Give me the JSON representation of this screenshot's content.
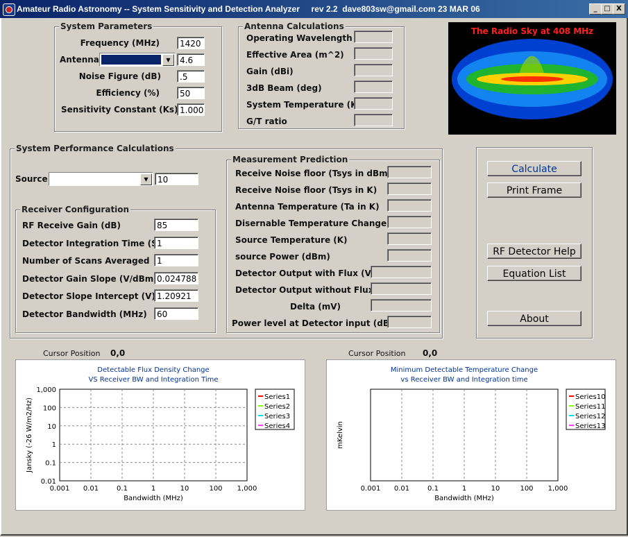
{
  "window": {
    "title": "Amateur Radio Astronomy -- System Sensitivity and Detection Analyzer     rev 2.2  dave803sw@gmail.com 23 MAR 06",
    "minimize": "_",
    "maximize": "□",
    "close": "X"
  },
  "system_params": {
    "legend": "System Parameters",
    "frequency_label": "Frequency (MHz)",
    "frequency": "1420",
    "antenna_label": "Antenna",
    "antenna": "4.6",
    "noise_label": "Noise Figure (dB)",
    "noise": ".5",
    "efficiency_label": "Efficiency (%)",
    "efficiency": "50",
    "ks_label": "Sensitivity Constant (Ks)",
    "ks": "1.000"
  },
  "antenna_calc": {
    "legend": "Antenna Calculations",
    "rows": [
      "Operating Wavelength (m)",
      "Effective  Area (m^2)",
      "Gain (dBi)",
      "3dB Beam (deg)",
      "System Temperature (K)",
      "G/T ratio"
    ]
  },
  "sky": {
    "caption": "The Radio Sky at 408 MHz"
  },
  "perf": {
    "legend": "System Performance Calculations",
    "source_label": "Source",
    "source_value": "10"
  },
  "receiver": {
    "legend": "Receiver Configuration",
    "rows": [
      {
        "label": "RF Receive Gain (dB)",
        "value": "85"
      },
      {
        "label": "Detector Integration Time (S)",
        "value": "1"
      },
      {
        "label": "Number of Scans Averaged",
        "value": "1"
      },
      {
        "label": "Detector Gain Slope (V/dBm)",
        "value": "0.024788"
      },
      {
        "label": "Detector Slope Intercept (V)",
        "value": "1.20921"
      },
      {
        "label": "Detector Bandwidth (MHz)",
        "value": "60"
      }
    ]
  },
  "measurement": {
    "legend": "Measurement Prediction",
    "rows": [
      "Receive Noise floor (Tsys in dBm)",
      "Receive Noise floor (Tsys in K)",
      "Antenna Temperature  (Ta in K)",
      "Disernable Temperature Change (mK)",
      "Source Temperature (K)",
      "source Power (dBm)",
      "Detector Output with Flux (V)",
      "Detector Output without  Flux (V)",
      "Delta (mV)",
      "Power level at Detector input (dBm)"
    ]
  },
  "buttons": {
    "calculate": "Calculate",
    "print": "Print Frame",
    "rf_help": "RF Detector Help",
    "equations": "Equation List",
    "about": "About"
  },
  "cursor": {
    "label": "Cursor Position",
    "left_value": "0,0",
    "right_value": "0,0"
  },
  "chart_data": [
    {
      "type": "line",
      "title": "Detectable Flux Density Change",
      "subtitle": "VS Receiver BW and Integration Time",
      "xlabel": "Bandwidth (MHz)",
      "ylabel": "Jansky (-26 W/m2/Hz)",
      "x_scale": "log",
      "y_scale": "log",
      "xlim": [
        0.001,
        1000
      ],
      "ylim": [
        0.01,
        1000
      ],
      "x_ticks": [
        "0.001",
        "0.01",
        "0.1",
        "1",
        "10",
        "100",
        "1,000"
      ],
      "y_ticks": [
        "1,000",
        "100",
        "10",
        "1",
        "0.1",
        "0.01"
      ],
      "series": [
        {
          "name": "Series1",
          "color": "#ff0000",
          "values": []
        },
        {
          "name": "Series2",
          "color": "#80ff00",
          "values": []
        },
        {
          "name": "Series3",
          "color": "#00e0e0",
          "values": []
        },
        {
          "name": "Series4",
          "color": "#ff40ff",
          "values": []
        }
      ],
      "grid": true,
      "legend": "right"
    },
    {
      "type": "line",
      "title": "Minimum Detectable Temperature Change",
      "subtitle": "vs Receiver BW and Integration time",
      "xlabel": "Bandwidth (MHz)",
      "ylabel": "mKelvin",
      "x_scale": "log",
      "xlim": [
        0.001,
        1000
      ],
      "x_ticks": [
        "0.001",
        "0.01",
        "0.1",
        "1",
        "10",
        "100",
        "1,000"
      ],
      "y_ticks": [],
      "series": [
        {
          "name": "Series10",
          "color": "#ff0000",
          "values": []
        },
        {
          "name": "Series11",
          "color": "#80ff00",
          "values": []
        },
        {
          "name": "Series12",
          "color": "#00e0e0",
          "values": []
        },
        {
          "name": "Series13",
          "color": "#ff40ff",
          "values": []
        }
      ],
      "grid": true,
      "legend": "right"
    }
  ]
}
